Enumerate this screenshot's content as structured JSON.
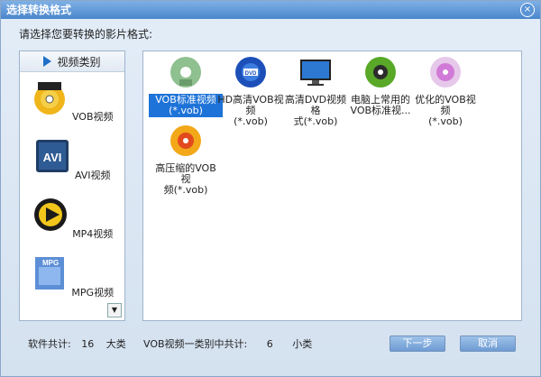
{
  "window": {
    "title": "选择转换格式",
    "close_glyph": "×"
  },
  "prompt": "请选择您要转换的影片格式:",
  "sidebar": {
    "header": "视频类别",
    "categories": [
      {
        "label": "VOB视频",
        "icon": "vob-disc-icon"
      },
      {
        "label": "AVI视频",
        "icon": "avi-icon"
      },
      {
        "label": "MP4视频",
        "icon": "mp4-play-icon"
      },
      {
        "label": "MPG视频",
        "icon": "mpg-icon"
      }
    ]
  },
  "formats": [
    {
      "label": "VOB标准视频\n(*.vob)",
      "selected": true,
      "icon": "vob-standard-disc-icon"
    },
    {
      "label": "HD高清VOB视频\n(*.vob)",
      "selected": false,
      "icon": "dvd-disc-icon"
    },
    {
      "label": "高清DVD视频格\n式(*.vob)",
      "selected": false,
      "icon": "monitor-icon"
    },
    {
      "label": "电脑上常用的\nVOB标准视...",
      "selected": false,
      "icon": "green-disc-icon"
    },
    {
      "label": "优化的VOB视频\n(*.vob)",
      "selected": false,
      "icon": "pink-disc-icon"
    },
    {
      "label": "高压缩的VOB视\n频(*.vob)",
      "selected": false,
      "icon": "compressed-disc-icon"
    }
  ],
  "footer": {
    "total_label": "软件共计:",
    "total_count": "16",
    "total_unit": "大类",
    "category_label": "VOB视频一类别中共计:",
    "category_count": "6",
    "category_unit": "小类"
  },
  "buttons": {
    "next": "下一步",
    "cancel": "取消"
  }
}
